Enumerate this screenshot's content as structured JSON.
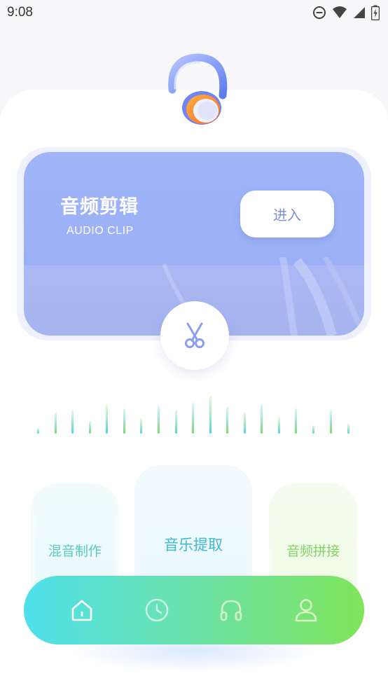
{
  "status_bar": {
    "time": "9:08",
    "icons": [
      "do-not-disturb-icon",
      "wifi-icon",
      "signal-icon",
      "battery-charging-icon"
    ]
  },
  "header": {
    "logo_icon": "headphone-icon"
  },
  "hero": {
    "title": "音频剪辑",
    "subtitle": "AUDIO CLIP",
    "enter_label": "进入",
    "action_icon": "scissors-icon",
    "colors": {
      "card": "#a0b4f8",
      "button_text": "#7f8fd8"
    }
  },
  "waveform": {
    "colors": [
      "#4fd3e6",
      "#7ed96a"
    ]
  },
  "features": [
    {
      "label": "混音制作",
      "color": "#5ac9c0"
    },
    {
      "label": "音乐提取",
      "color": "#40b9d0"
    },
    {
      "label": "音频拼接",
      "color": "#82d266"
    }
  ],
  "tab_bar": {
    "items": [
      {
        "icon": "home-icon",
        "active": true
      },
      {
        "icon": "clock-icon",
        "active": false
      },
      {
        "icon": "headphones-icon",
        "active": false
      },
      {
        "icon": "user-icon",
        "active": false
      }
    ],
    "gradient": [
      "#4fe0ec",
      "#80e45a"
    ]
  }
}
